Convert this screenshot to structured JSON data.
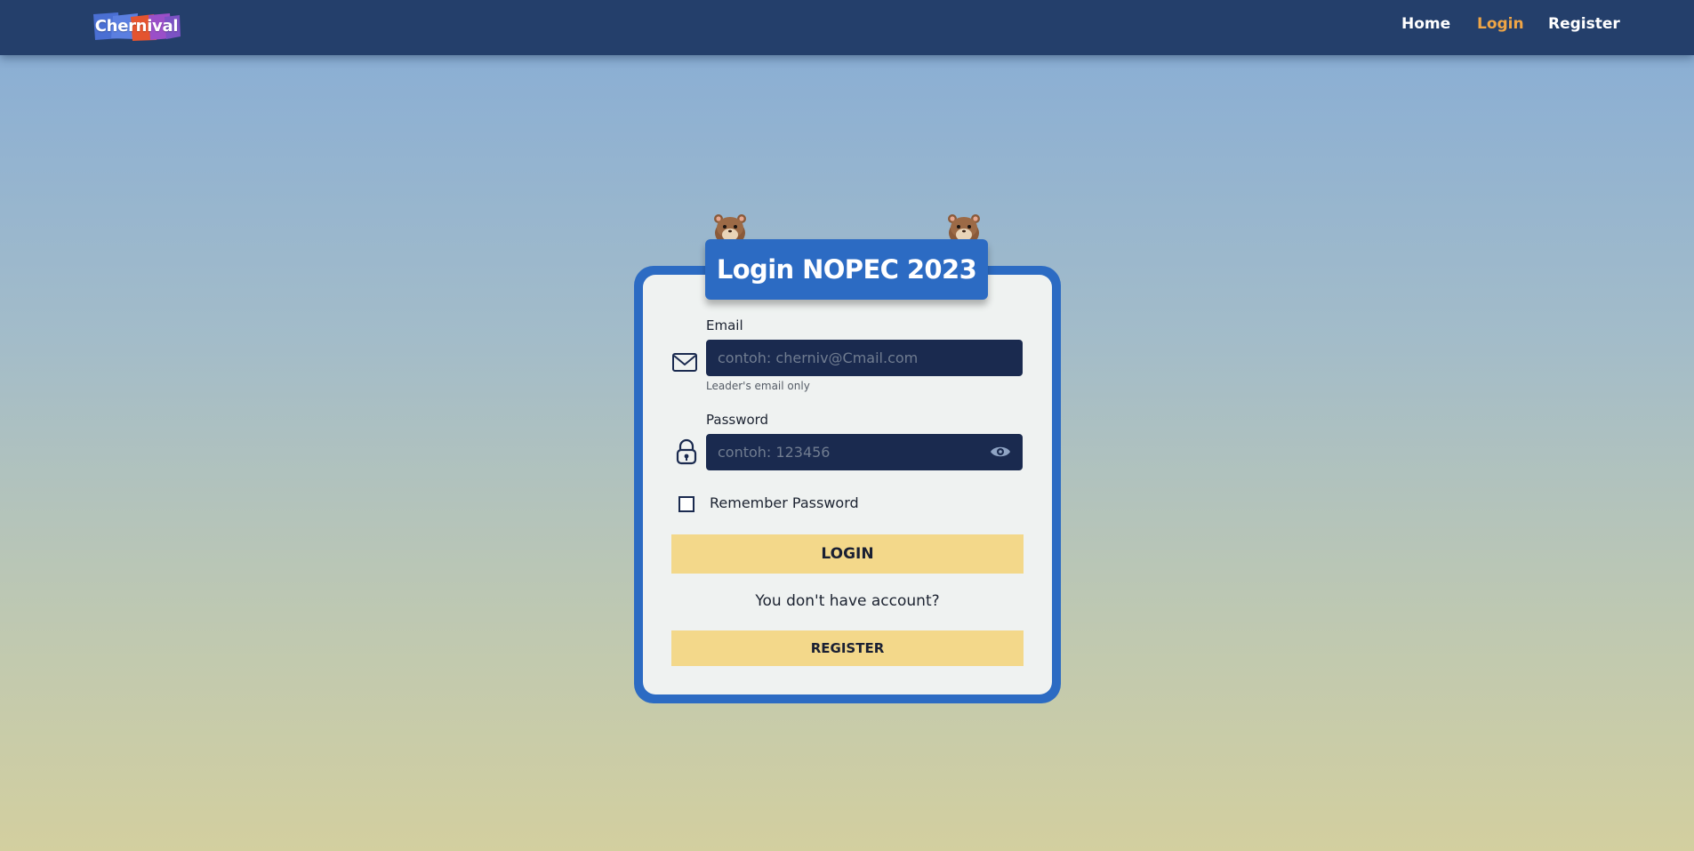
{
  "nav": {
    "logo_text": "Chernival",
    "links": [
      {
        "label": "Home",
        "active": false
      },
      {
        "label": "Login",
        "active": true
      },
      {
        "label": "Register",
        "active": false
      }
    ],
    "active_color": "#efa546",
    "bar_color": "#243f6b"
  },
  "form": {
    "title": "Login NOPEC 2023",
    "email_label": "Email",
    "email_placeholder": "contoh: cherniv@Cmail.com",
    "email_helper": "Leader's email only",
    "password_label": "Password",
    "password_placeholder": "contoh: 123456",
    "remember_label": "Remember Password",
    "remember_checked": false,
    "login_button": "LOGIN",
    "no_account_text": "You don't have account?",
    "register_button": "REGISTER"
  },
  "icons": {
    "email": "envelope-icon",
    "password": "lock-icon",
    "toggle_visibility": "eye-icon",
    "mascot": "hamster-icon"
  },
  "colors": {
    "primary": "#2c6bc3",
    "input_bg": "#1a2a4f",
    "button_bg": "#f3d88a",
    "card_bg": "#eff2f1"
  }
}
